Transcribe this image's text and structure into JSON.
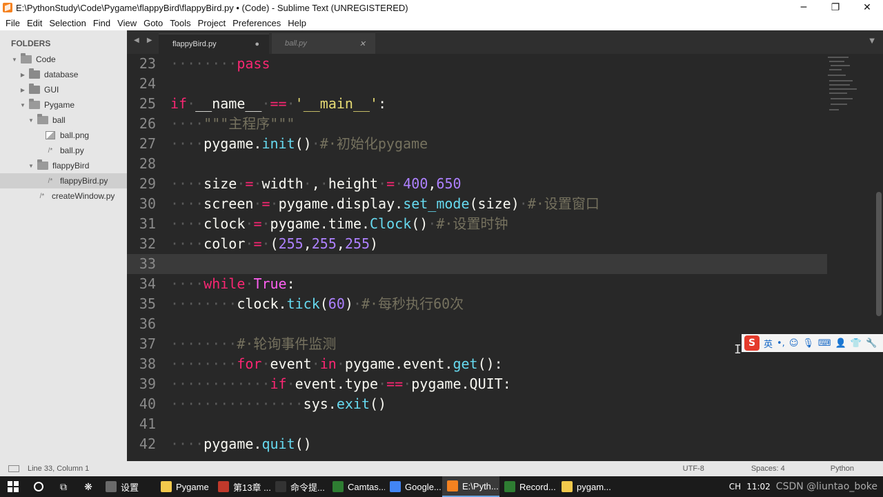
{
  "window": {
    "title": "E:\\PythonStudy\\Code\\Pygame\\flappyBird\\flappyBird.py • (Code) - Sublime Text (UNREGISTERED)",
    "minimize": "─",
    "maximize": "❐",
    "close": "✕"
  },
  "menu": [
    {
      "label": "File"
    },
    {
      "label": "Edit"
    },
    {
      "label": "Selection"
    },
    {
      "label": "Find"
    },
    {
      "label": "View"
    },
    {
      "label": "Goto"
    },
    {
      "label": "Tools"
    },
    {
      "label": "Project"
    },
    {
      "label": "Preferences"
    },
    {
      "label": "Help"
    }
  ],
  "sidebar": {
    "header": "FOLDERS",
    "items": [
      {
        "label": "Code"
      },
      {
        "label": "database"
      },
      {
        "label": "GUI"
      },
      {
        "label": "Pygame"
      },
      {
        "label": "ball"
      },
      {
        "label": "ball.png"
      },
      {
        "label": "ball.py"
      },
      {
        "label": "flappyBird"
      },
      {
        "label": "flappyBird.py"
      },
      {
        "label": "createWindow.py"
      }
    ]
  },
  "tabs": {
    "nav": "◀ ▶",
    "active": {
      "label": "flappyBird.py",
      "marker": "●"
    },
    "inactive": {
      "label": "ball.py",
      "marker": "✕"
    },
    "overflow": "▼"
  },
  "editor": {
    "line_numbers": [
      "23",
      "24",
      "25",
      "26",
      "27",
      "28",
      "29",
      "30",
      "31",
      "32",
      "33",
      "34",
      "35",
      "36",
      "37",
      "38",
      "39",
      "40",
      "41",
      "42"
    ],
    "current_line": "33"
  },
  "ime": {
    "mode": "英",
    "punct": "•,"
  },
  "status": {
    "position": "Line 33, Column 1",
    "encoding": "UTF-8",
    "indent": "Spaces: 4",
    "syntax": "Python"
  },
  "taskbar": {
    "items": [
      {
        "label": "设置",
        "color": "#6a6a6a"
      },
      {
        "label": "Pygame",
        "color": "#f2c94c"
      },
      {
        "label": "第13章 ...",
        "color": "#c0392b"
      },
      {
        "label": "命令提...",
        "color": "#333333"
      },
      {
        "label": "Camtas...",
        "color": "#2e7d32"
      },
      {
        "label": "Google...",
        "color": "#4285f4"
      },
      {
        "label": "E:\\Pyth...",
        "color": "#f58220"
      },
      {
        "label": "Record...",
        "color": "#2e7d32"
      },
      {
        "label": "pygam...",
        "color": "#f2c94c"
      }
    ],
    "tray": {
      "lang": "CH",
      "time": "11:02",
      "watermark": "CSDN @liuntao_boke"
    }
  }
}
